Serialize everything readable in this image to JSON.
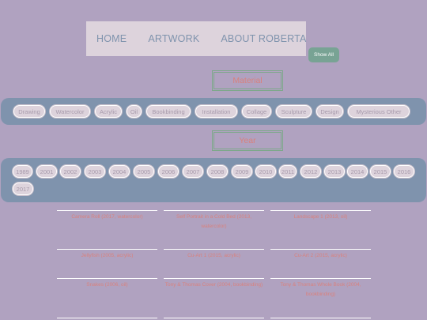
{
  "nav": {
    "items": [
      {
        "label": "HOME"
      },
      {
        "label": "ARTWORK"
      },
      {
        "label": "ABOUT ROBERTA"
      }
    ]
  },
  "show_all_label": "Show All",
  "material": {
    "title": "Material",
    "chips": [
      "Drawing",
      "Watercolor",
      "Acrylic",
      "Oil",
      "Bookbinding",
      "Installation",
      "Collage",
      "Sculpture",
      "Design",
      "Mysterious Other"
    ]
  },
  "year": {
    "title": "Year",
    "chips": [
      "1989",
      "2001",
      "2002",
      "2003",
      "2004",
      "2005",
      "2006",
      "2007",
      "2008",
      "2009",
      "2010",
      "2011",
      "2012",
      "2013",
      "2014",
      "2015",
      "2016",
      "2017"
    ]
  },
  "artworks": [
    {
      "caption": "Camera Roll (2017, watercolor)"
    },
    {
      "caption": "Self Portrait in a Cold Bed (2013, watercolor)"
    },
    {
      "caption": "Landscape 1 (2013, oil)"
    },
    {
      "caption": "Jellyfish (2005, acrylic)"
    },
    {
      "caption": "Cu-Art 1 (2015, acrylic)"
    },
    {
      "caption": "Cu-Art 2 (2015, acrylic)"
    },
    {
      "caption": "Snakes (2006, oil)"
    },
    {
      "caption": "Tony & Thomas Cover (2004, bookbinding)"
    },
    {
      "caption": "Tony & Thomas Whole Book (2004, bookbinding)"
    }
  ],
  "colors": {
    "background": "#b0a2c0",
    "band": "#7f93ad",
    "chip": "#ddd3dc",
    "accent": "#d9817d",
    "button": "#78a394"
  }
}
